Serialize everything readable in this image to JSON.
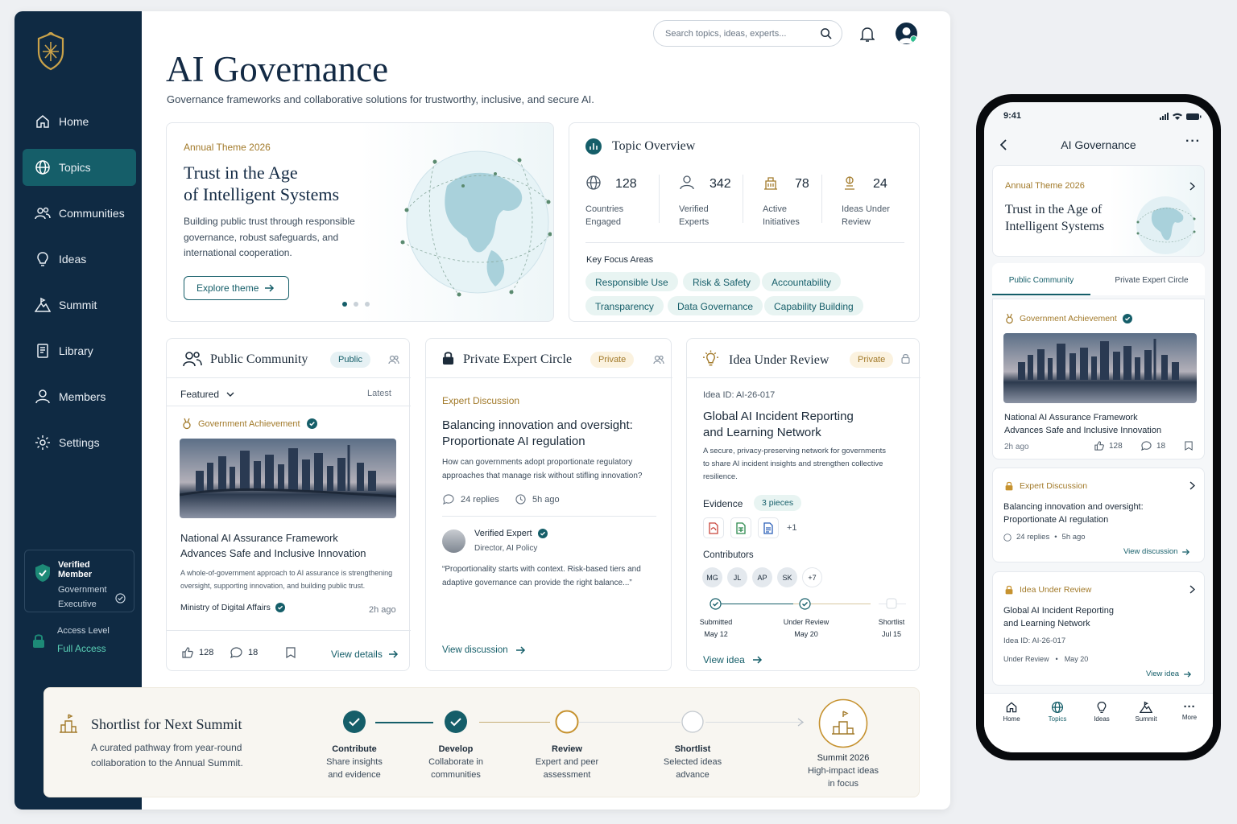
{
  "sidebar": {
    "items": [
      {
        "label": "Home"
      },
      {
        "label": "Topics"
      },
      {
        "label": "Communities"
      },
      {
        "label": "Ideas"
      },
      {
        "label": "Summit"
      },
      {
        "label": "Library"
      },
      {
        "label": "Members"
      },
      {
        "label": "Settings"
      }
    ],
    "verified": {
      "title": "Verified Member",
      "line1": "Government",
      "line2": "Executive"
    },
    "access": {
      "label": "Access Level",
      "value": "Full Access"
    }
  },
  "header": {
    "search_placeholder": "Search topics, ideas, experts...",
    "title": "AI Governance",
    "subtitle": "Governance frameworks and collaborative solutions for trustworthy, inclusive, and secure AI."
  },
  "theme": {
    "eyebrow": "Annual Theme 2026",
    "title1": "Trust in the Age",
    "title2": "of Intelligent Systems",
    "desc1": "Building public trust through responsible",
    "desc2": "governance, robust safeguards, and",
    "desc3": "international cooperation.",
    "button": "Explore theme"
  },
  "overview": {
    "title": "Topic Overview",
    "stats": [
      {
        "value": "128",
        "l1": "Countries",
        "l2": "Engaged"
      },
      {
        "value": "342",
        "l1": "Verified",
        "l2": "Experts"
      },
      {
        "value": "78",
        "l1": "Active",
        "l2": "Initiatives"
      },
      {
        "value": "24",
        "l1": "Ideas Under",
        "l2": "Review"
      }
    ],
    "focus_label": "Key Focus Areas",
    "focus": [
      "Responsible Use",
      "Risk & Safety",
      "Accountability",
      "Transparency",
      "Data Governance",
      "Capability Building"
    ]
  },
  "public": {
    "title": "Public Community",
    "tag": "Public",
    "filter": "Featured",
    "sort": "Latest",
    "badge": "Government Achievement",
    "post1": "National AI Assurance Framework",
    "post2": "Advances Safe and Inclusive Innovation",
    "body1": "A whole-of-government approach to AI assurance is strengthening",
    "body2": "oversight, supporting innovation, and building public trust.",
    "org": "Ministry of Digital Affairs",
    "time": "2h ago",
    "likes": "128",
    "comments": "18",
    "link": "View details"
  },
  "private": {
    "title": "Private Expert Circle",
    "tag": "Private",
    "eyebrow": "Expert Discussion",
    "q1": "Balancing innovation and oversight:",
    "q2": "Proportionate AI regulation",
    "b1": "How can governments adopt proportionate regulatory",
    "b2": "approaches that manage risk without stifling innovation?",
    "replies": "24 replies",
    "time": "5h ago",
    "expert": "Verified Expert",
    "role": "Director, AI Policy",
    "quote1": "“Proportionality starts with context. Risk-based tiers and",
    "quote2": "adaptive governance can provide the right balance...”",
    "link": "View discussion"
  },
  "idea": {
    "title": "Idea Under Review",
    "tag": "Private",
    "id": "Idea ID: AI-26-017",
    "t1": "Global AI Incident Reporting",
    "t2": "and Learning Network",
    "d1": "A secure, privacy-preserving network for governments",
    "d2": "to share AI incident insights and strengthen collective",
    "d3": "resilience.",
    "evidence": "Evidence",
    "pieces": "3 pieces",
    "more": "+1",
    "contributors": "Contributors",
    "people": [
      "MG",
      "JL",
      "AP",
      "SK",
      "+7"
    ],
    "steps": [
      {
        "l": "Submitted",
        "d": "May 12"
      },
      {
        "l": "Under Review",
        "d": "May 20"
      },
      {
        "l": "Shortlist",
        "d": "Jul 15"
      }
    ],
    "link": "View idea"
  },
  "shortlist": {
    "title": "Shortlist for Next Summit",
    "d1": "A curated pathway from year-round",
    "d2": "collaboration to the Annual Summit.",
    "steps": [
      {
        "t": "Contribute",
        "a": "Share insights",
        "b": "and evidence"
      },
      {
        "t": "Develop",
        "a": "Collaborate in",
        "b": "communities"
      },
      {
        "t": "Review",
        "a": "Expert and peer",
        "b": "assessment"
      },
      {
        "t": "Shortlist",
        "a": "Selected ideas",
        "b": "advance"
      },
      {
        "t": "Summit 2026",
        "a": "High-impact ideas",
        "b": "in focus"
      }
    ]
  },
  "mobile": {
    "time": "9:41",
    "title": "AI Governance",
    "eyebrow": "Annual Theme 2026",
    "t1": "Trust in the Age of",
    "t2": "Intelligent Systems",
    "tab1": "Public Community",
    "tab2": "Private Expert Circle",
    "badge": "Government Achievement",
    "p1": "National AI Assurance Framework",
    "p2": "Advances Safe and Inclusive Innovation",
    "ago": "2h ago",
    "likes": "128",
    "comments": "18",
    "disc_eyebrow": "Expert Discussion",
    "dq1": "Balancing innovation and oversight:",
    "dq2": "Proportionate AI regulation",
    "dreplies": "24 replies",
    "dtime": "5h ago",
    "dlink": "View discussion",
    "idea_eyebrow": "Idea Under Review",
    "it1": "Global AI Incident Reporting",
    "it2": "and Learning Network",
    "iid": "Idea ID: AI-26-017",
    "istatus": "Under Review",
    "idate": "May 20",
    "ilink": "View idea",
    "nav": [
      "Home",
      "Topics",
      "Ideas",
      "Summit",
      "More"
    ]
  },
  "colors": {
    "navy": "#0f2a43",
    "teal": "#155e69",
    "gold": "#a27a2a"
  }
}
